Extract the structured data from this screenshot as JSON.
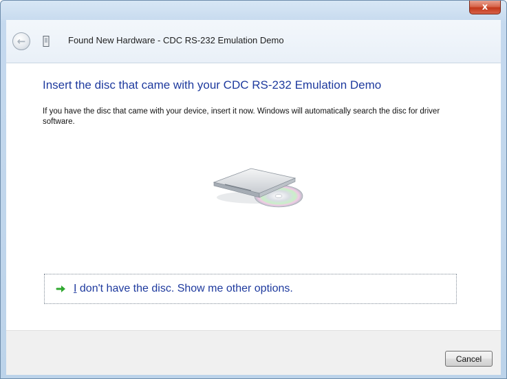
{
  "window": {
    "title": "Found New Hardware - CDC RS-232 Emulation Demo",
    "close_symbol": "x"
  },
  "nav": {
    "back_icon": "back-arrow-icon",
    "device_icon": "usb-device-icon"
  },
  "main": {
    "heading": "Insert the disc that came with your CDC RS-232 Emulation Demo",
    "body": "If you have the disc that came with your device, insert it now.  Windows will automatically search the disc for driver software.",
    "illustration": "disc-drive-icon",
    "option": {
      "icon": "green-arrow-icon",
      "accel_key": "I",
      "label_rest": " don't have the disc.  Show me other options."
    }
  },
  "footer": {
    "cancel_label": "Cancel"
  },
  "colors": {
    "heading": "#1e3a9e",
    "link": "#1e3a9e",
    "arrow": "#2fa82f",
    "close": "#c2381a"
  }
}
